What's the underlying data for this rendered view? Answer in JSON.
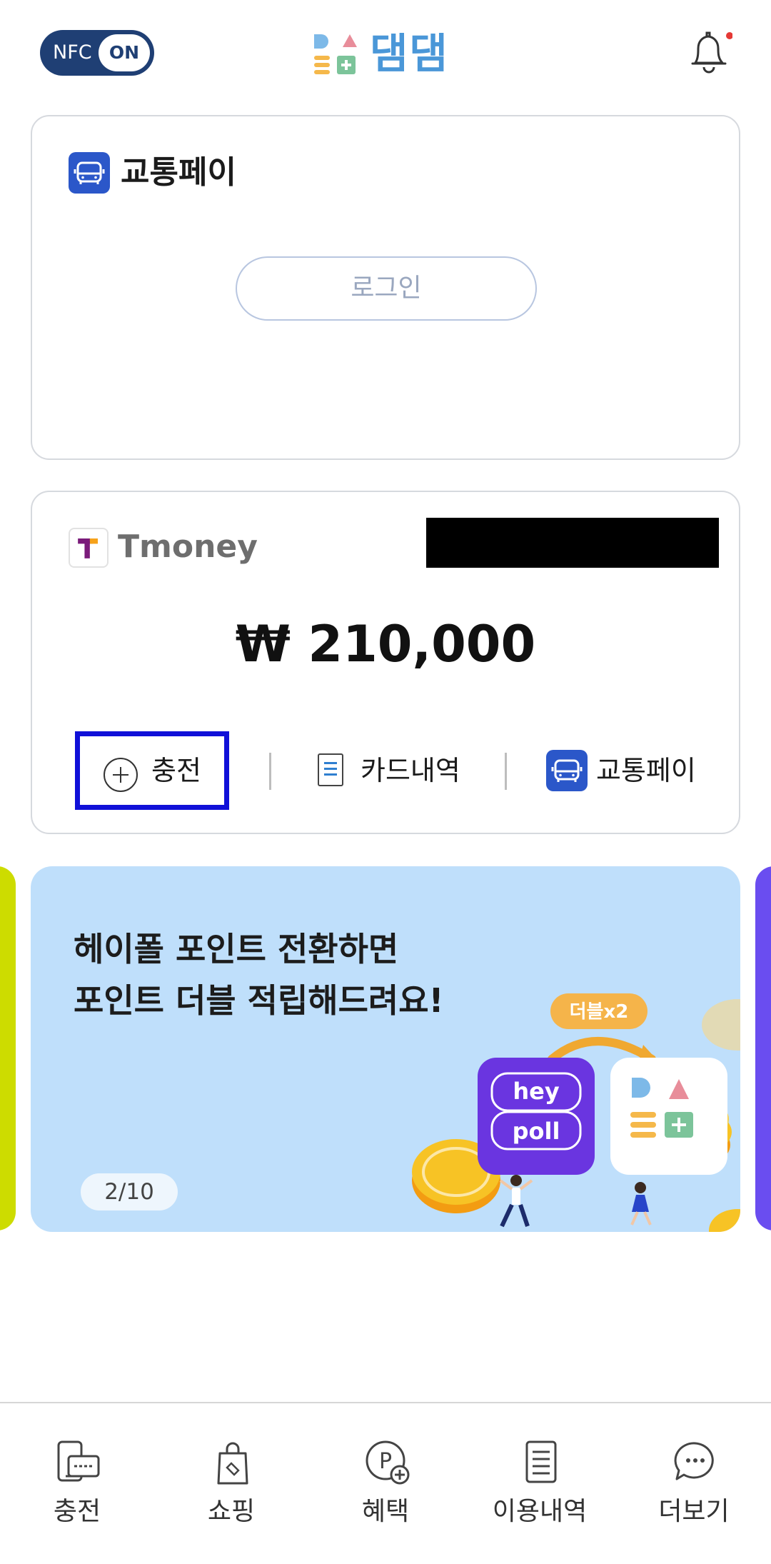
{
  "header": {
    "nfc_label": "NFC",
    "nfc_state": "ON",
    "logo_text": "댐댐",
    "has_notification": true
  },
  "transit_card": {
    "title": "교통페이",
    "login_label": "로그인"
  },
  "tmoney_card": {
    "brand": "Tmoney",
    "balance": "₩ 210,000",
    "actions": {
      "charge": "충전",
      "card_history": "카드내역",
      "transit_pay": "교통페이"
    }
  },
  "banner": {
    "line1": "헤이폴 포인트 전환하면",
    "line2": "포인트 더블 적립해드려요!",
    "badge": "더블x2",
    "app_tag_top": "hey",
    "app_tag_bottom": "poll",
    "pager": "2/10"
  },
  "bottom_nav": {
    "items": [
      {
        "label": "충전",
        "icon": "charge-device-icon"
      },
      {
        "label": "쇼핑",
        "icon": "shopping-bag-icon"
      },
      {
        "label": "혜택",
        "icon": "points-icon"
      },
      {
        "label": "이용내역",
        "icon": "history-list-icon"
      },
      {
        "label": "더보기",
        "icon": "more-chat-icon"
      }
    ]
  },
  "colors": {
    "brand_blue": "#4a97d8",
    "nfc_toggle": "#1f3f74",
    "bus_badge": "#2b57c9",
    "highlight_box": "#1010d8",
    "banner_bg": "#bfdffb"
  }
}
